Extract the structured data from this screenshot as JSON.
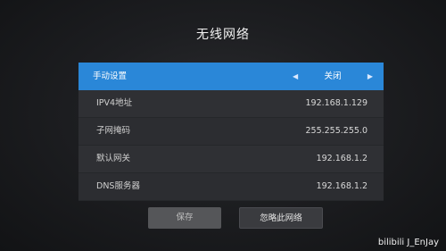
{
  "title": "无线网络",
  "rows": [
    {
      "label": "手动设置",
      "value": "关闭",
      "selected": true
    },
    {
      "label": "IPV4地址",
      "value": "192.168.1.129"
    },
    {
      "label": "子网掩码",
      "value": "255.255.255.0"
    },
    {
      "label": "默认网关",
      "value": "192.168.1.2"
    },
    {
      "label": "DNS服务器",
      "value": "192.168.1.2"
    }
  ],
  "buttons": {
    "save": "保存",
    "ignore": "忽略此网络"
  },
  "watermark": "bilibili J_EnJay",
  "colors": {
    "selected": "#2a87d8",
    "background": "#1d1e21",
    "row": "#2f3034"
  },
  "icons": {
    "left": "triangle-left",
    "right": "triangle-right"
  }
}
